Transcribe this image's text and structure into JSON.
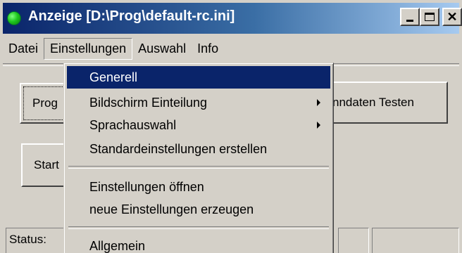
{
  "window": {
    "title": "Anzeige [D:\\Prog\\default-rc.ini]",
    "close_glyph": "✕"
  },
  "menubar": {
    "items": [
      {
        "label": "Datei"
      },
      {
        "label": "Einstellungen"
      },
      {
        "label": "Auswahl"
      },
      {
        "label": "Info"
      }
    ]
  },
  "buttons": {
    "prog_label": "Prog",
    "test_label": "nndaten Testen",
    "start_label": "Start"
  },
  "status": {
    "label": "Status:"
  },
  "dropdown": {
    "items": [
      {
        "label": "Generell"
      },
      {
        "label": "Bildschirm Einteilung"
      },
      {
        "label": "Sprachauswahl"
      },
      {
        "label": "Standardeinstellungen erstellen"
      },
      {
        "label": "Einstellungen öffnen"
      },
      {
        "label": "neue Einstellungen erzeugen"
      },
      {
        "label": "Allgemein"
      }
    ]
  },
  "colors": {
    "titlebar_start": "#0a246a",
    "titlebar_end": "#a6caf0",
    "face": "#d4d0c8",
    "selection": "#0a246a",
    "app_icon": "#1fc81f"
  },
  "icons": {
    "app": "green-circle-icon",
    "minimize": "minimize-icon",
    "maximize": "maximize-icon",
    "close": "close-icon",
    "submenu": "submenu-arrow-icon"
  }
}
